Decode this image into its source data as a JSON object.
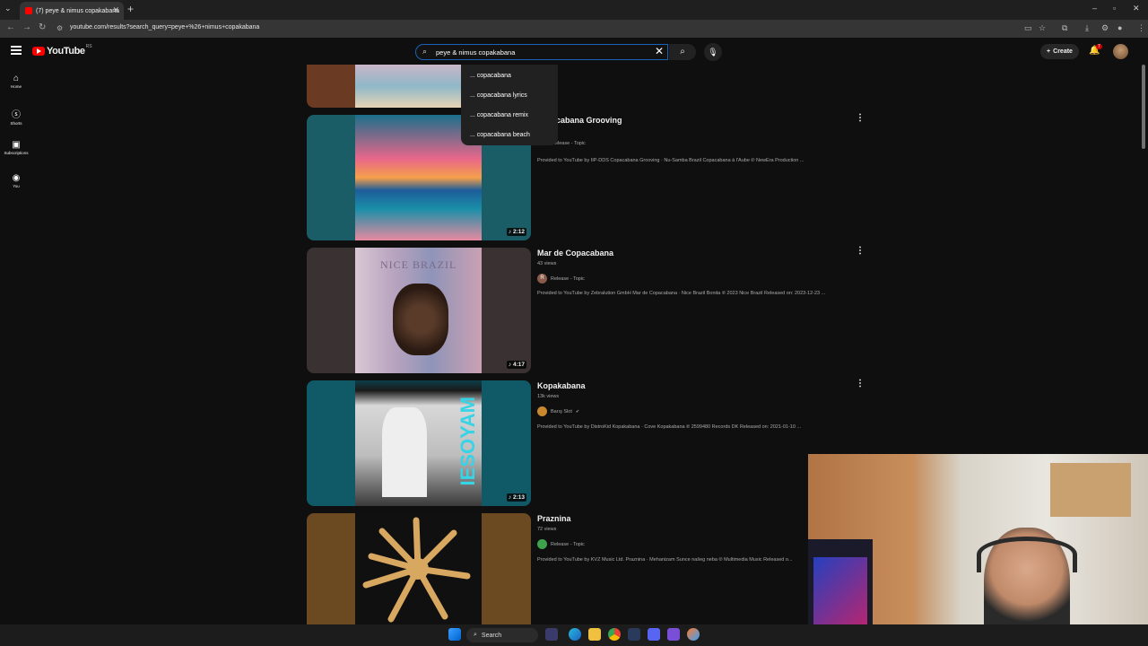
{
  "browser": {
    "tab_title": "(7) peye & nimus copakabana",
    "url": "youtube.com/results?search_query=peye+%26+nimus+copakabana"
  },
  "header": {
    "logo_text": "YouTube",
    "country_code": "RS",
    "search_value": "peye & nimus copakabana",
    "create_label": "Create",
    "notification_count": "7"
  },
  "sidebar": {
    "items": [
      {
        "label": "Home",
        "icon": "home-icon"
      },
      {
        "label": "Shorts",
        "icon": "shorts-icon"
      },
      {
        "label": "Subscriptions",
        "icon": "subscriptions-icon"
      },
      {
        "label": "You",
        "icon": "you-icon"
      }
    ]
  },
  "suggestions": [
    "... copacabana",
    "... copacabana lyrics",
    "... copacabana remix",
    "... copacabana beach"
  ],
  "results": [
    {
      "title": "Copacabana Grooving",
      "title_visible": "cabana Grooving",
      "channel": "Release - Topic",
      "description": "Provided to YouTube by IIP-DDS Copacabana Grooving · Nu-Samba Brazil Copacabana à l'Aube ℗ NewEra Production ...",
      "duration": "2:12",
      "thumb_color": "#1b5d66"
    },
    {
      "title": "Mar de Copacabana",
      "views": "43 views",
      "channel": "Release - Topic",
      "channel_initial": "R",
      "description": "Provided to YouTube by Zebralution GmbH Mar de Copacabana · Nice Brazil Bonita ℗ 2023 Nice Brazil Released on: 2023-12-23 ...",
      "duration": "4:17",
      "thumb_color": "#3a3232",
      "art_text": "NICE BRAZIL"
    },
    {
      "title": "Kopakabana",
      "views": "13k views",
      "channel": "Barış Slot",
      "description": "Provided to YouTube by DistroKid Kopakabana · Cove Kopakabana ℗ 2599480 Records DK Released on: 2021-01-10 ...",
      "duration": "2:13",
      "thumb_color": "#0f5a66",
      "art_text": "IESOYAM"
    },
    {
      "title": "Praznina",
      "views": "72 views",
      "channel": "Release - Topic",
      "description": "Provided to YouTube by KVZ Music Ltd. Praznina · Mehanizam Sunce našeg neba ℗ Multimedia Music Released o...",
      "thumb_color": "#6b4a22"
    }
  ],
  "taskbar": {
    "search_label": "Search"
  },
  "colors": {
    "youtube_red": "#ff0000",
    "search_focus": "#1c62b9",
    "background": "#0f0f0f"
  }
}
